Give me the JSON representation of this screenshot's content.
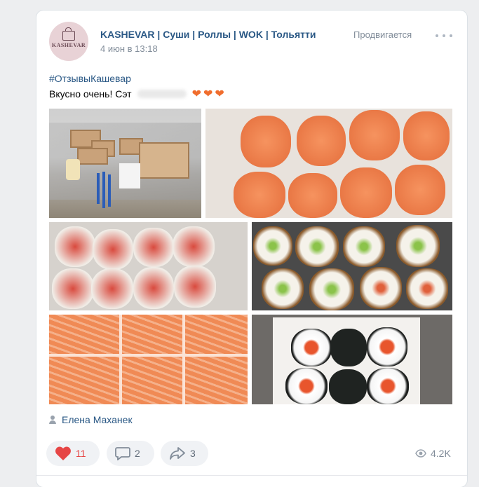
{
  "post": {
    "author": "KASHEVAR | Суши | Роллы | WOK | Тольятти",
    "date": "4 июн в 13:18",
    "promoted_label": "Продвигается",
    "avatar_text": "KASHEVAR",
    "hashtag": "#ОтзывыКашевар",
    "text": "Вкусно очень! Сэт",
    "hearts": "❤❤❤",
    "signer": "Елена Маханек",
    "likes": "11",
    "comments": "2",
    "shares": "3",
    "views": "4.2K"
  },
  "colors": {
    "link": "#2a5885",
    "like": "#e64646",
    "muted": "#818c99",
    "background": "#edeef0"
  },
  "icons": [
    "more-icon",
    "heart-icon",
    "comment-icon",
    "share-icon",
    "eye-icon",
    "user-icon"
  ]
}
